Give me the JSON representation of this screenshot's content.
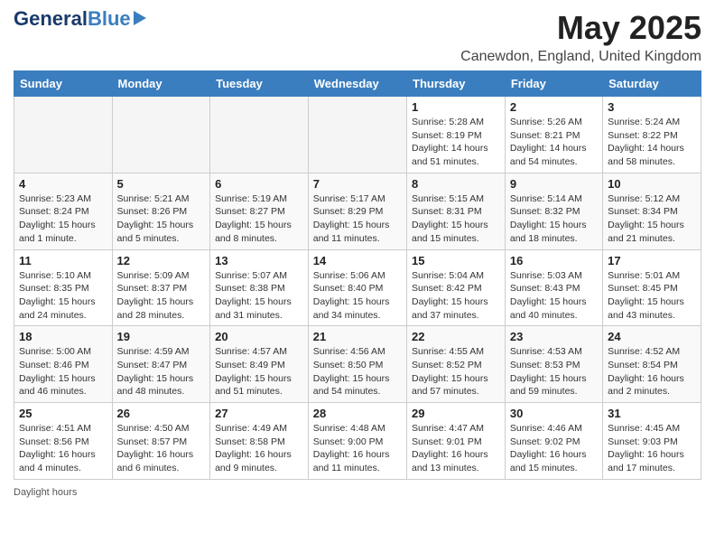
{
  "header": {
    "logo": {
      "general": "General",
      "blue": "Blue"
    },
    "title": "May 2025",
    "location": "Canewdon, England, United Kingdom"
  },
  "calendar": {
    "days_of_week": [
      "Sunday",
      "Monday",
      "Tuesday",
      "Wednesday",
      "Thursday",
      "Friday",
      "Saturday"
    ],
    "weeks": [
      [
        {
          "day": "",
          "info": ""
        },
        {
          "day": "",
          "info": ""
        },
        {
          "day": "",
          "info": ""
        },
        {
          "day": "",
          "info": ""
        },
        {
          "day": "1",
          "info": "Sunrise: 5:28 AM\nSunset: 8:19 PM\nDaylight: 14 hours and 51 minutes."
        },
        {
          "day": "2",
          "info": "Sunrise: 5:26 AM\nSunset: 8:21 PM\nDaylight: 14 hours and 54 minutes."
        },
        {
          "day": "3",
          "info": "Sunrise: 5:24 AM\nSunset: 8:22 PM\nDaylight: 14 hours and 58 minutes."
        }
      ],
      [
        {
          "day": "4",
          "info": "Sunrise: 5:23 AM\nSunset: 8:24 PM\nDaylight: 15 hours and 1 minute."
        },
        {
          "day": "5",
          "info": "Sunrise: 5:21 AM\nSunset: 8:26 PM\nDaylight: 15 hours and 5 minutes."
        },
        {
          "day": "6",
          "info": "Sunrise: 5:19 AM\nSunset: 8:27 PM\nDaylight: 15 hours and 8 minutes."
        },
        {
          "day": "7",
          "info": "Sunrise: 5:17 AM\nSunset: 8:29 PM\nDaylight: 15 hours and 11 minutes."
        },
        {
          "day": "8",
          "info": "Sunrise: 5:15 AM\nSunset: 8:31 PM\nDaylight: 15 hours and 15 minutes."
        },
        {
          "day": "9",
          "info": "Sunrise: 5:14 AM\nSunset: 8:32 PM\nDaylight: 15 hours and 18 minutes."
        },
        {
          "day": "10",
          "info": "Sunrise: 5:12 AM\nSunset: 8:34 PM\nDaylight: 15 hours and 21 minutes."
        }
      ],
      [
        {
          "day": "11",
          "info": "Sunrise: 5:10 AM\nSunset: 8:35 PM\nDaylight: 15 hours and 24 minutes."
        },
        {
          "day": "12",
          "info": "Sunrise: 5:09 AM\nSunset: 8:37 PM\nDaylight: 15 hours and 28 minutes."
        },
        {
          "day": "13",
          "info": "Sunrise: 5:07 AM\nSunset: 8:38 PM\nDaylight: 15 hours and 31 minutes."
        },
        {
          "day": "14",
          "info": "Sunrise: 5:06 AM\nSunset: 8:40 PM\nDaylight: 15 hours and 34 minutes."
        },
        {
          "day": "15",
          "info": "Sunrise: 5:04 AM\nSunset: 8:42 PM\nDaylight: 15 hours and 37 minutes."
        },
        {
          "day": "16",
          "info": "Sunrise: 5:03 AM\nSunset: 8:43 PM\nDaylight: 15 hours and 40 minutes."
        },
        {
          "day": "17",
          "info": "Sunrise: 5:01 AM\nSunset: 8:45 PM\nDaylight: 15 hours and 43 minutes."
        }
      ],
      [
        {
          "day": "18",
          "info": "Sunrise: 5:00 AM\nSunset: 8:46 PM\nDaylight: 15 hours and 46 minutes."
        },
        {
          "day": "19",
          "info": "Sunrise: 4:59 AM\nSunset: 8:47 PM\nDaylight: 15 hours and 48 minutes."
        },
        {
          "day": "20",
          "info": "Sunrise: 4:57 AM\nSunset: 8:49 PM\nDaylight: 15 hours and 51 minutes."
        },
        {
          "day": "21",
          "info": "Sunrise: 4:56 AM\nSunset: 8:50 PM\nDaylight: 15 hours and 54 minutes."
        },
        {
          "day": "22",
          "info": "Sunrise: 4:55 AM\nSunset: 8:52 PM\nDaylight: 15 hours and 57 minutes."
        },
        {
          "day": "23",
          "info": "Sunrise: 4:53 AM\nSunset: 8:53 PM\nDaylight: 15 hours and 59 minutes."
        },
        {
          "day": "24",
          "info": "Sunrise: 4:52 AM\nSunset: 8:54 PM\nDaylight: 16 hours and 2 minutes."
        }
      ],
      [
        {
          "day": "25",
          "info": "Sunrise: 4:51 AM\nSunset: 8:56 PM\nDaylight: 16 hours and 4 minutes."
        },
        {
          "day": "26",
          "info": "Sunrise: 4:50 AM\nSunset: 8:57 PM\nDaylight: 16 hours and 6 minutes."
        },
        {
          "day": "27",
          "info": "Sunrise: 4:49 AM\nSunset: 8:58 PM\nDaylight: 16 hours and 9 minutes."
        },
        {
          "day": "28",
          "info": "Sunrise: 4:48 AM\nSunset: 9:00 PM\nDaylight: 16 hours and 11 minutes."
        },
        {
          "day": "29",
          "info": "Sunrise: 4:47 AM\nSunset: 9:01 PM\nDaylight: 16 hours and 13 minutes."
        },
        {
          "day": "30",
          "info": "Sunrise: 4:46 AM\nSunset: 9:02 PM\nDaylight: 16 hours and 15 minutes."
        },
        {
          "day": "31",
          "info": "Sunrise: 4:45 AM\nSunset: 9:03 PM\nDaylight: 16 hours and 17 minutes."
        }
      ]
    ]
  },
  "footer": {
    "daylight_label": "Daylight hours"
  }
}
